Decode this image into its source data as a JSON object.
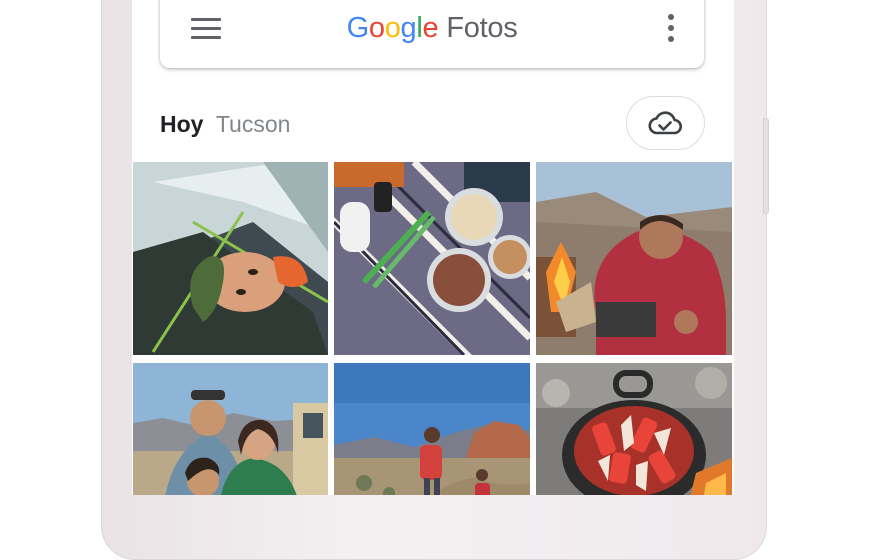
{
  "app": {
    "brand_parts": [
      "G",
      "o",
      "o",
      "g",
      "l",
      "e"
    ],
    "product_name": "Fotos"
  },
  "header": {
    "menu_icon": "hamburger-menu-icon",
    "more_icon": "more-vert-icon"
  },
  "section": {
    "date_label": "Hoy",
    "location_label": "Tucson",
    "backup_icon": "cloud-done-icon"
  },
  "photos": [
    {
      "subject": "child-in-tent",
      "icon": "photo"
    },
    {
      "subject": "camp-food-on-blanket",
      "icon": "photo"
    },
    {
      "subject": "man-cooking-at-campfire",
      "icon": "photo"
    },
    {
      "subject": "family-selfie-desert",
      "icon": "photo"
    },
    {
      "subject": "hikers-on-trail",
      "icon": "photo"
    },
    {
      "subject": "dutch-oven-vegetables",
      "icon": "photo"
    }
  ],
  "colors": {
    "google_blue": "#4285f4",
    "google_red": "#ea4335",
    "google_yellow": "#fbbc05",
    "google_green": "#34a853",
    "icon_grey": "#5f6368"
  }
}
